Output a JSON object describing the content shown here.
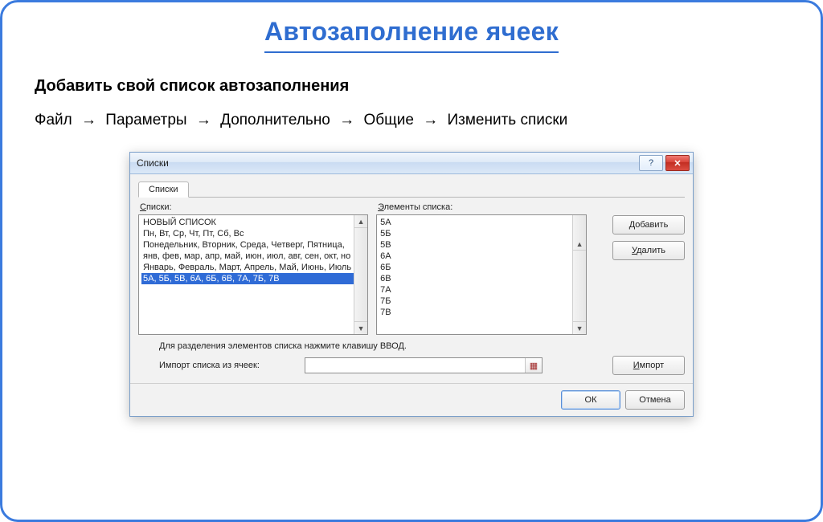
{
  "slide": {
    "title": "Автозаполнение ячеек",
    "subtitle": "Добавить свой список автозаполнения",
    "path": [
      "Файл",
      "Параметры",
      "Дополнительно",
      "Общие",
      "Изменить списки"
    ]
  },
  "dialog": {
    "caption": "Списки",
    "tab": "Списки",
    "labels": {
      "lists_u": "С",
      "lists_rest": "писки:",
      "elements_u": "Э",
      "elements_rest": "лементы списка:",
      "add_u": "Д",
      "add_rest": "обавить",
      "del_u": "У",
      "del_rest": "далить",
      "import_btn_u": "И",
      "import_btn_rest": "мпорт",
      "hint": "Для разделения элементов списка нажмите клавишу ВВОД.",
      "import_from": "Импорт списка из ячеек:",
      "ok": "ОК",
      "cancel": "Отмена"
    },
    "lists": [
      "НОВЫЙ СПИСОК",
      "Пн, Вт, Ср, Чт, Пт, Сб, Вс",
      "Понедельник, Вторник, Среда, Четверг, Пятница,",
      "янв, фев, мар, апр, май, июн, июл, авг, сен, окт, но",
      "Январь, Февраль, Март, Апрель, Май, Июнь, Июль",
      "5А, 5Б, 5В, 6А, 6Б, 6В, 7А, 7Б, 7В"
    ],
    "selected_index": 5,
    "elements": [
      "5А",
      "5Б",
      "5В",
      "6А",
      "6Б",
      "6В",
      "7А",
      "7Б",
      "7В"
    ]
  }
}
